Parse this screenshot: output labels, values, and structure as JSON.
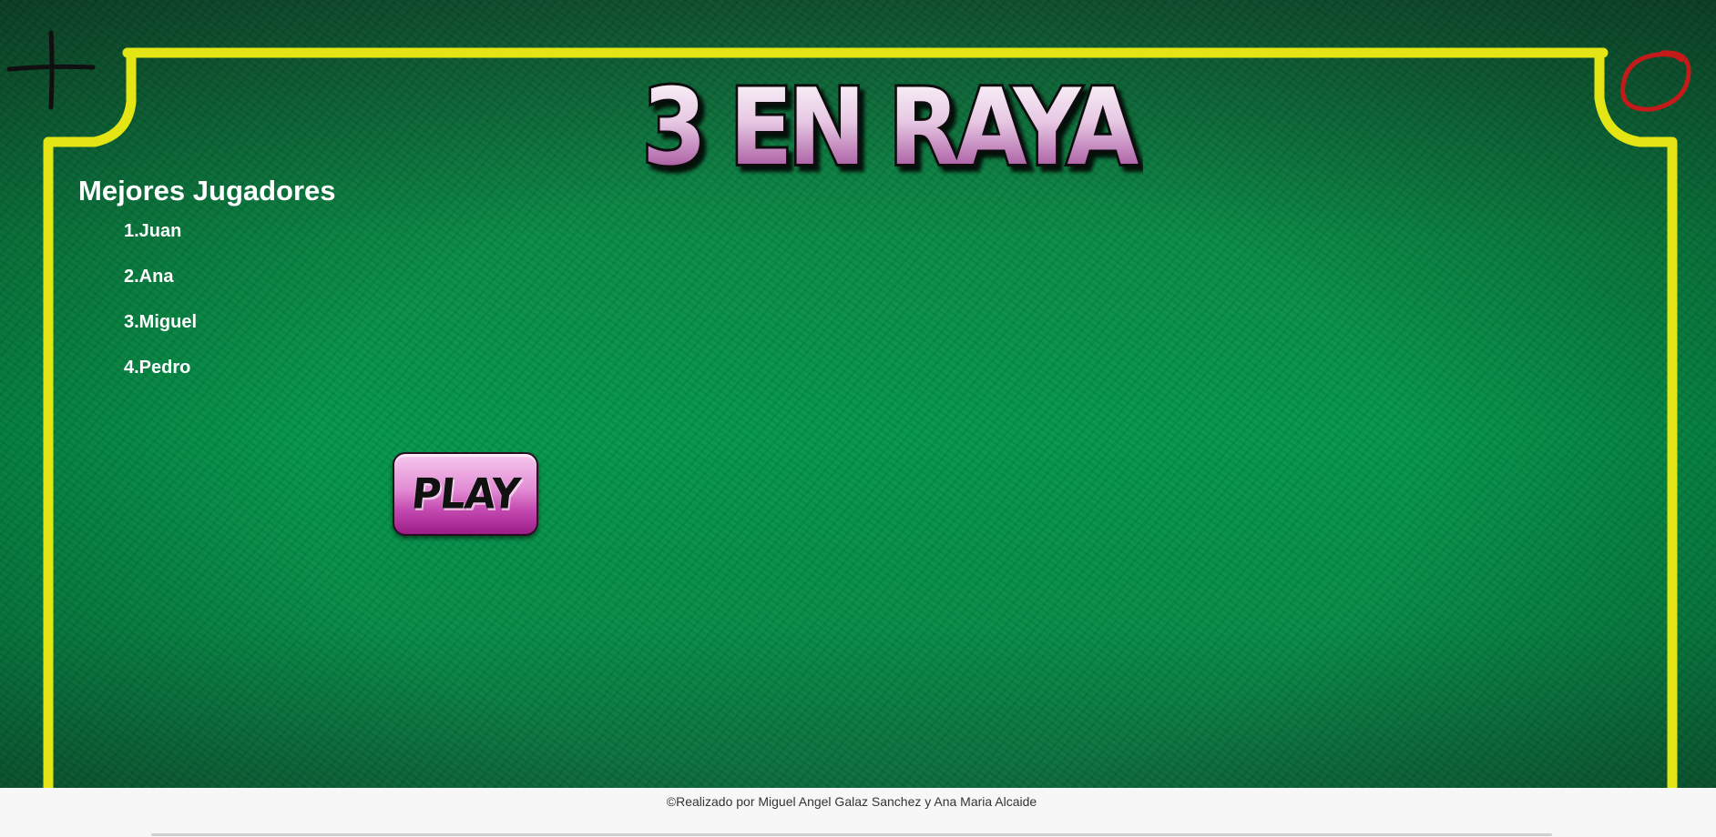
{
  "game": {
    "title": "3 EN RAYA",
    "corner_left_symbol": "cross-mark",
    "corner_right_symbol": "circle-mark"
  },
  "leaderboard": {
    "heading": "Mejores Jugadores",
    "players": [
      "1.Juan",
      "2.Ana",
      "3.Miguel",
      "4.Pedro"
    ]
  },
  "play_button": {
    "label": "PLAY"
  },
  "footer": {
    "credit": "©Realizado por Miguel Angel Galaz Sanchez y Ana Maria Alcaide"
  },
  "colors": {
    "frame": "#e3e614",
    "felt": "#02954a",
    "title_fill_top": "#ffffff",
    "title_fill_bottom": "#8e2a85",
    "button": "#c449b0",
    "circle_mark": "#c41a1a"
  }
}
